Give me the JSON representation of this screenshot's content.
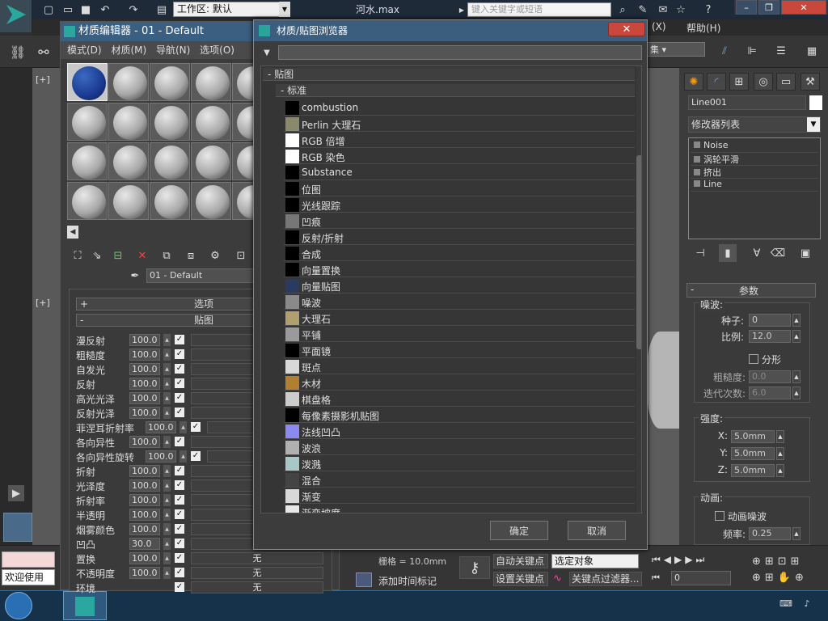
{
  "topbar": {
    "workspace_label": "工作区: 默认",
    "file_name": "河水.max",
    "search_placeholder": "键入关键字或短语"
  },
  "menubar_right": {
    "x_item": "(X)",
    "help": "帮助(H)"
  },
  "material_editor": {
    "title": "材质编辑器 - 01 - Default",
    "menu": [
      "模式(D)",
      "材质(M)",
      "导航(N)",
      "选项(O)"
    ],
    "material_name": "01 - Default",
    "rollouts": {
      "options": "选项",
      "maps": "贴图"
    },
    "maps": [
      {
        "label": "漫反射",
        "amount": "100.0",
        "slot": ""
      },
      {
        "label": "粗糙度",
        "amount": "100.0",
        "slot": ""
      },
      {
        "label": "自发光",
        "amount": "100.0",
        "slot": ""
      },
      {
        "label": "反射",
        "amount": "100.0",
        "slot": ""
      },
      {
        "label": "高光光泽",
        "amount": "100.0",
        "slot": ""
      },
      {
        "label": "反射光泽",
        "amount": "100.0",
        "slot": ""
      },
      {
        "label": "菲涅耳折射率",
        "amount": "100.0",
        "slot": ""
      },
      {
        "label": "各向异性",
        "amount": "100.0",
        "slot": ""
      },
      {
        "label": "各向异性旋转",
        "amount": "100.0",
        "slot": ""
      },
      {
        "label": "折射",
        "amount": "100.0",
        "slot": ""
      },
      {
        "label": "光泽度",
        "amount": "100.0",
        "slot": ""
      },
      {
        "label": "折射率",
        "amount": "100.0",
        "slot": ""
      },
      {
        "label": "半透明",
        "amount": "100.0",
        "slot": ""
      },
      {
        "label": "烟雾颜色",
        "amount": "100.0",
        "slot": ""
      },
      {
        "label": "凹凸",
        "amount": "30.0",
        "slot": ""
      },
      {
        "label": "置换",
        "amount": "100.0",
        "slot": "无"
      },
      {
        "label": "不透明度",
        "amount": "100.0",
        "slot": "无"
      },
      {
        "label": "环境",
        "amount": "",
        "slot": "无"
      }
    ]
  },
  "browser": {
    "title": "材质/贴图浏览器",
    "group_maps": "贴图",
    "group_standard": "标准",
    "items": [
      {
        "name": "combustion",
        "swatch": "#000000"
      },
      {
        "name": "Perlin 大理石",
        "swatch": "#8a8a6a"
      },
      {
        "name": "RGB 倍增",
        "swatch": "#ffffff"
      },
      {
        "name": "RGB 染色",
        "swatch": "#ffffff"
      },
      {
        "name": "Substance",
        "swatch": "#000000"
      },
      {
        "name": "位图",
        "swatch": "#000000"
      },
      {
        "name": "光线跟踪",
        "swatch": "#000000"
      },
      {
        "name": "凹痕",
        "swatch": "#777777"
      },
      {
        "name": "反射/折射",
        "swatch": "#000000"
      },
      {
        "name": "合成",
        "swatch": "#000000"
      },
      {
        "name": "向量置换",
        "swatch": "#000000"
      },
      {
        "name": "向量贴图",
        "swatch": "#2a3a60"
      },
      {
        "name": "噪波",
        "swatch": "#8a8a8a"
      },
      {
        "name": "大理石",
        "swatch": "#b0a070"
      },
      {
        "name": "平铺",
        "swatch": "#9a9a9a"
      },
      {
        "name": "平面镜",
        "swatch": "#000000"
      },
      {
        "name": "斑点",
        "swatch": "#d8d8d8"
      },
      {
        "name": "木材",
        "swatch": "#b08030"
      },
      {
        "name": "棋盘格",
        "swatch": "#cccccc"
      },
      {
        "name": "每像素摄影机贴图",
        "swatch": "#000000"
      },
      {
        "name": "法线凹凸",
        "swatch": "#8a8af0"
      },
      {
        "name": "波浪",
        "swatch": "#b0b0b0"
      },
      {
        "name": "泼溅",
        "swatch": "#a8c8c8"
      },
      {
        "name": "混合",
        "swatch": "#444444"
      },
      {
        "name": "渐变",
        "swatch": "#d8d8d8"
      },
      {
        "name": "渐变坡度",
        "swatch": "#e8e8e8"
      }
    ],
    "ok": "确定",
    "cancel": "取消"
  },
  "command_panel": {
    "object_name": "Line001",
    "modifier_list": "修改器列表",
    "stack": [
      "Noise",
      "涡轮平滑",
      "挤出",
      "Line"
    ],
    "params_title": "参数",
    "noise_group": "噪波:",
    "seed_label": "种子:",
    "seed": "0",
    "scale_label": "比例:",
    "scale": "12.0",
    "fractal_label": "分形",
    "roughness_label": "粗糙度:",
    "roughness": "0.0",
    "iterations_label": "迭代次数:",
    "iterations": "6.0",
    "strength_group": "强度:",
    "x_label": "X:",
    "x": "5.0mm",
    "y_label": "Y:",
    "y": "5.0mm",
    "z_label": "Z:",
    "z": "5.0mm",
    "anim_group": "动画:",
    "anim_noise_label": "动画噪波",
    "freq_label": "频率:",
    "freq": "0.25"
  },
  "bottom": {
    "welcome": "欢迎使用",
    "grid": "栅格 = 10.0mm",
    "auto_key": "自动关键点",
    "set_key": "设置关键点",
    "selected": "选定对象",
    "add_time_tag": "添加时间标记",
    "key_filter": "关键点过滤器...",
    "frame": "0"
  },
  "viewport": {
    "label1": "[+]",
    "label2": "[+]"
  }
}
